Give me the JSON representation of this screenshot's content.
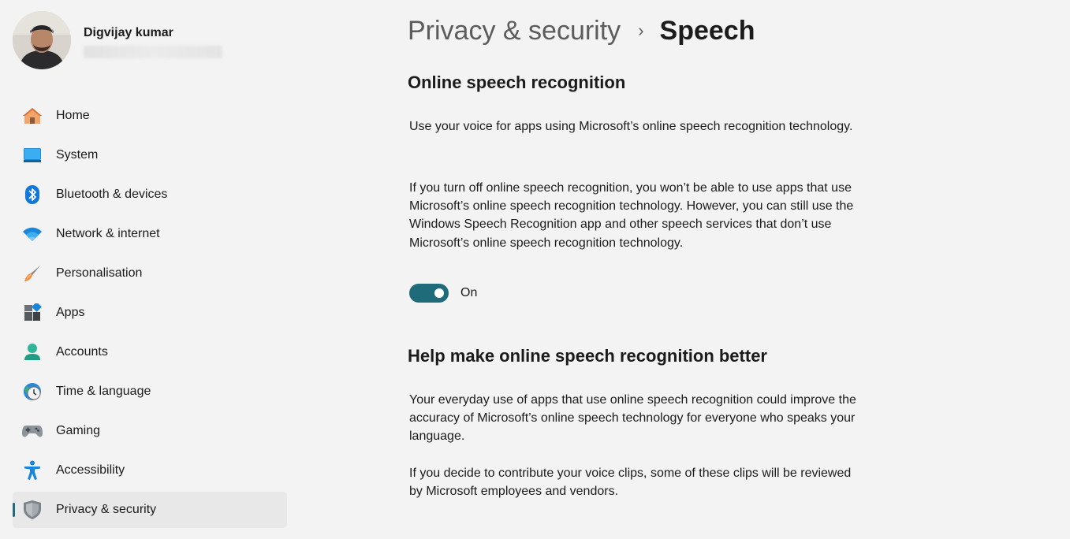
{
  "profile": {
    "name": "Digvijay kumar"
  },
  "nav": [
    {
      "label": "Home",
      "icon": "home-icon"
    },
    {
      "label": "System",
      "icon": "system-icon"
    },
    {
      "label": "Bluetooth & devices",
      "icon": "bluetooth-icon"
    },
    {
      "label": "Network & internet",
      "icon": "wifi-icon"
    },
    {
      "label": "Personalisation",
      "icon": "brush-icon"
    },
    {
      "label": "Apps",
      "icon": "apps-icon"
    },
    {
      "label": "Accounts",
      "icon": "accounts-icon"
    },
    {
      "label": "Time & language",
      "icon": "clock-globe-icon"
    },
    {
      "label": "Gaming",
      "icon": "gamepad-icon"
    },
    {
      "label": "Accessibility",
      "icon": "accessibility-icon"
    },
    {
      "label": "Privacy & security",
      "icon": "shield-icon",
      "selected": true
    }
  ],
  "breadcrumb": {
    "parent": "Privacy & security",
    "separator": "›",
    "current": "Speech"
  },
  "section1": {
    "heading": "Online speech recognition",
    "para1": "Use your voice for apps using Microsoft’s online speech recognition technology.",
    "para2": "If you turn off online speech recognition, you won’t be able to use apps that use Microsoft’s online speech recognition technology.  However, you can still use the Windows Speech Recognition app and other speech services that don’t use Microsoft’s online speech recognition technology.",
    "toggle_state": "On"
  },
  "section2": {
    "heading": "Help make online speech recognition better",
    "para1": "Your everyday use of apps that use online speech recognition could improve the accuracy of Microsoft’s online speech technology for everyone who speaks your language.",
    "para2": "If you decide to contribute your voice clips, some of these clips will be reviewed by Microsoft employees and vendors."
  },
  "colors": {
    "accent": "#1f6b7a",
    "background": "#f3f3f3",
    "selected_bg": "#e8e8e8"
  }
}
